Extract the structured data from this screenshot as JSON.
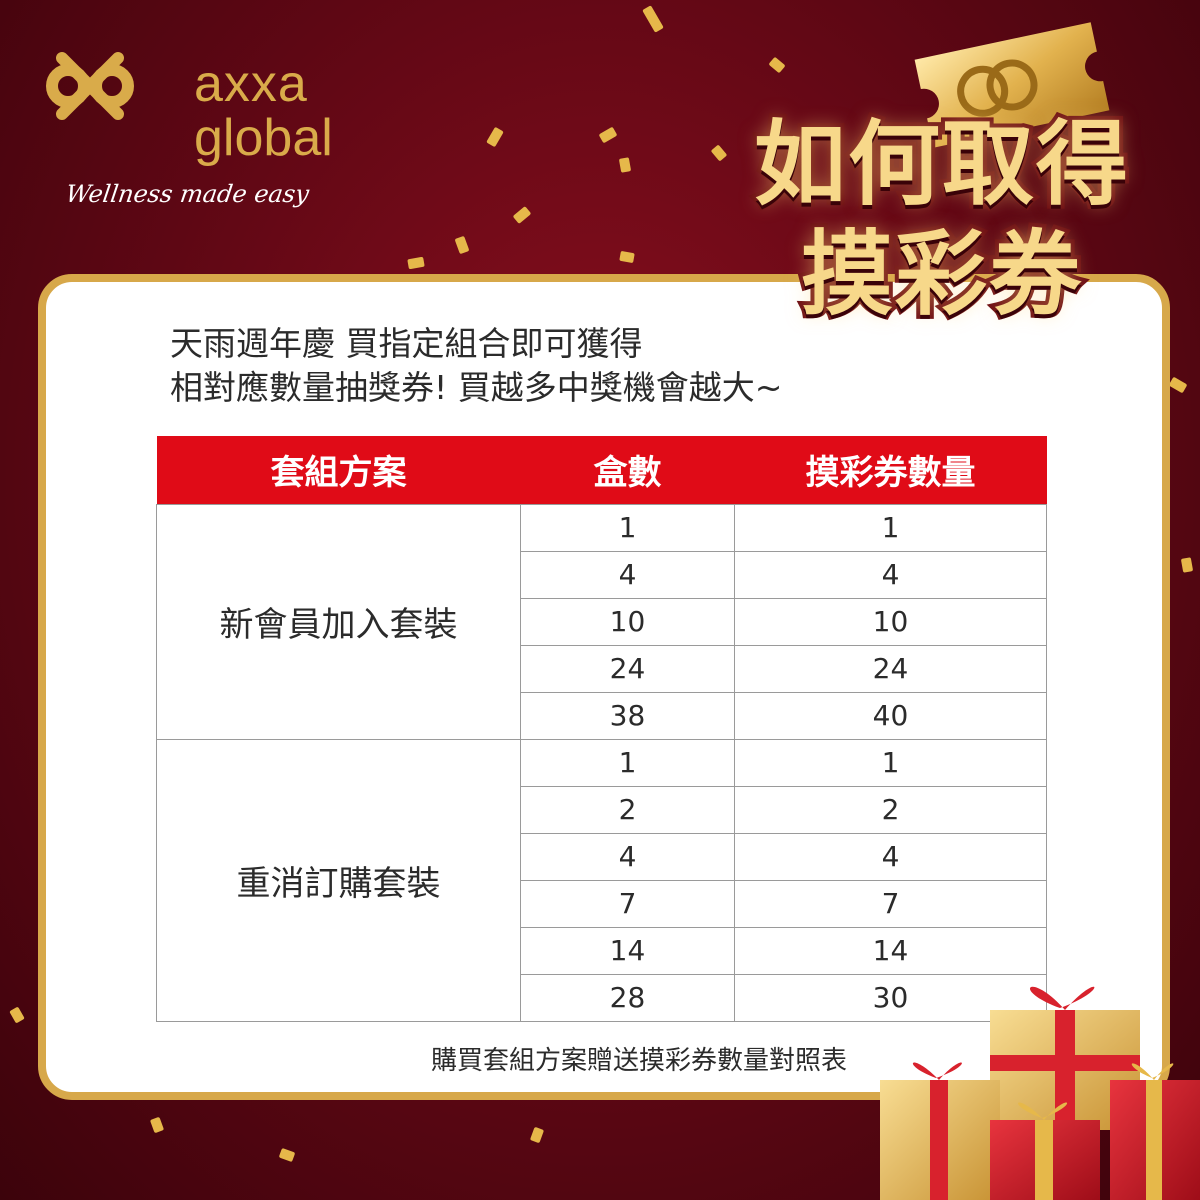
{
  "brand": {
    "line1": "axxa",
    "line2": "global",
    "tagline": "Wellness made easy",
    "logo_icon": "interlocking-loops-logo-icon",
    "gold": "#d9ab4a"
  },
  "headline": {
    "line1": "如何取得",
    "line2": "摸彩券"
  },
  "intro": {
    "line1": "天雨週年慶 買指定組合即可獲得",
    "line2": "相對應數量抽獎券! 買越多中獎機會越大~"
  },
  "table": {
    "header_color": "#e00b17",
    "columns": [
      "套組方案",
      "盒數",
      "摸彩券數量"
    ],
    "groups": [
      {
        "name": "新會員加入套裝",
        "rows": [
          {
            "boxes": "1",
            "tickets": "1"
          },
          {
            "boxes": "4",
            "tickets": "4"
          },
          {
            "boxes": "10",
            "tickets": "10"
          },
          {
            "boxes": "24",
            "tickets": "24"
          },
          {
            "boxes": "38",
            "tickets": "40"
          }
        ]
      },
      {
        "name": "重消訂購套裝",
        "rows": [
          {
            "boxes": "1",
            "tickets": "1"
          },
          {
            "boxes": "2",
            "tickets": "2"
          },
          {
            "boxes": "4",
            "tickets": "4"
          },
          {
            "boxes": "7",
            "tickets": "7"
          },
          {
            "boxes": "14",
            "tickets": "14"
          },
          {
            "boxes": "28",
            "tickets": "30"
          }
        ]
      }
    ]
  },
  "caption": "購買套組方案贈送摸彩券數量對照表",
  "decor": {
    "ticket_icon": "golden-ticket-icon",
    "gifts_icon": "gift-boxes-icon",
    "confetti_color": "#e6b84a",
    "background": "#5e0714"
  }
}
